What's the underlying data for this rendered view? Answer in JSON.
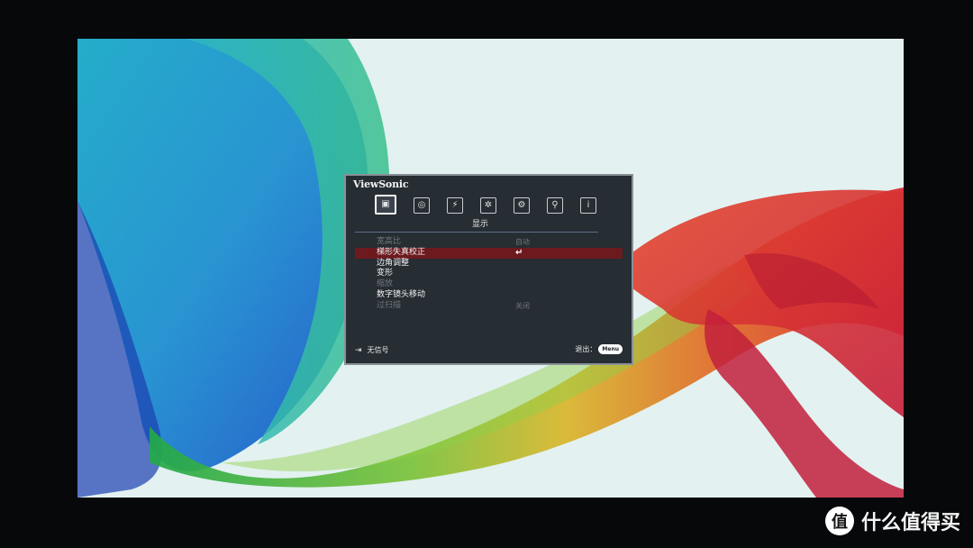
{
  "osd": {
    "brand": "ViewSonic",
    "tabs": [
      {
        "icon": "display-icon",
        "glyph": "▣",
        "active": true
      },
      {
        "icon": "image-icon",
        "glyph": "◎",
        "active": false
      },
      {
        "icon": "power-icon",
        "glyph": "⚡",
        "active": false
      },
      {
        "icon": "basic-settings-icon",
        "glyph": "✲",
        "active": false
      },
      {
        "icon": "advanced-settings-icon",
        "glyph": "⚙",
        "active": false
      },
      {
        "icon": "system-icon",
        "glyph": "⚲",
        "active": false
      },
      {
        "icon": "info-icon",
        "glyph": "i",
        "active": false
      }
    ],
    "section_title": "显示",
    "items": [
      {
        "label": "宽高比",
        "value": "自动",
        "disabled": true
      },
      {
        "label": "梯形失真校正",
        "value": "↵",
        "selected": true
      },
      {
        "label": "边角调整",
        "value": ""
      },
      {
        "label": "变形",
        "value": ""
      },
      {
        "label": "缩放",
        "value": "",
        "disabled": true
      },
      {
        "label": "数字镜头移动",
        "value": ""
      },
      {
        "label": "过扫描",
        "value": "关闭",
        "disabled": true
      }
    ],
    "footer": {
      "source_status": "无信号",
      "exit_label": "退出：",
      "menu_key": "Menu"
    }
  },
  "watermark": {
    "badge": "值",
    "text": "什么值得买"
  },
  "colors": {
    "osd_bg": "#262d33",
    "selected_row": "#6d1a1f",
    "accent_line": "#5a6f89"
  }
}
